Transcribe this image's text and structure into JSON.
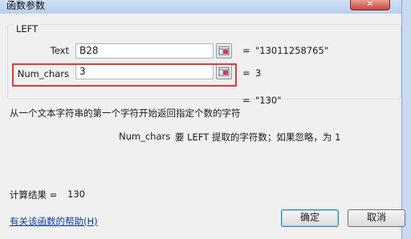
{
  "window": {
    "title": "函数参数",
    "close_glyph": "✕"
  },
  "function": {
    "name": "LEFT"
  },
  "args": [
    {
      "label": "Text",
      "value": "B28",
      "eq": "=",
      "result": "\"13011258765\""
    },
    {
      "label": "Num_chars",
      "value": "3",
      "eq": "=",
      "result": "3"
    }
  ],
  "function_result": {
    "eq": "=",
    "value": "\"130\""
  },
  "description": "从一个文本字符串的第一个字符开始返回指定个数的字符",
  "arg_help": {
    "name": "Num_chars",
    "text": "要 LEFT 提取的字符数；如果忽略，为 1"
  },
  "calc": {
    "label": "计算结果 =",
    "value": "130"
  },
  "help_link": "有关该函数的帮助(H)",
  "buttons": {
    "ok": "确定",
    "cancel": "取消"
  },
  "colors": {
    "highlight": "#e03a3a",
    "link": "#0a3c9e"
  },
  "icons": {
    "ref_button": "range-select-icon"
  }
}
